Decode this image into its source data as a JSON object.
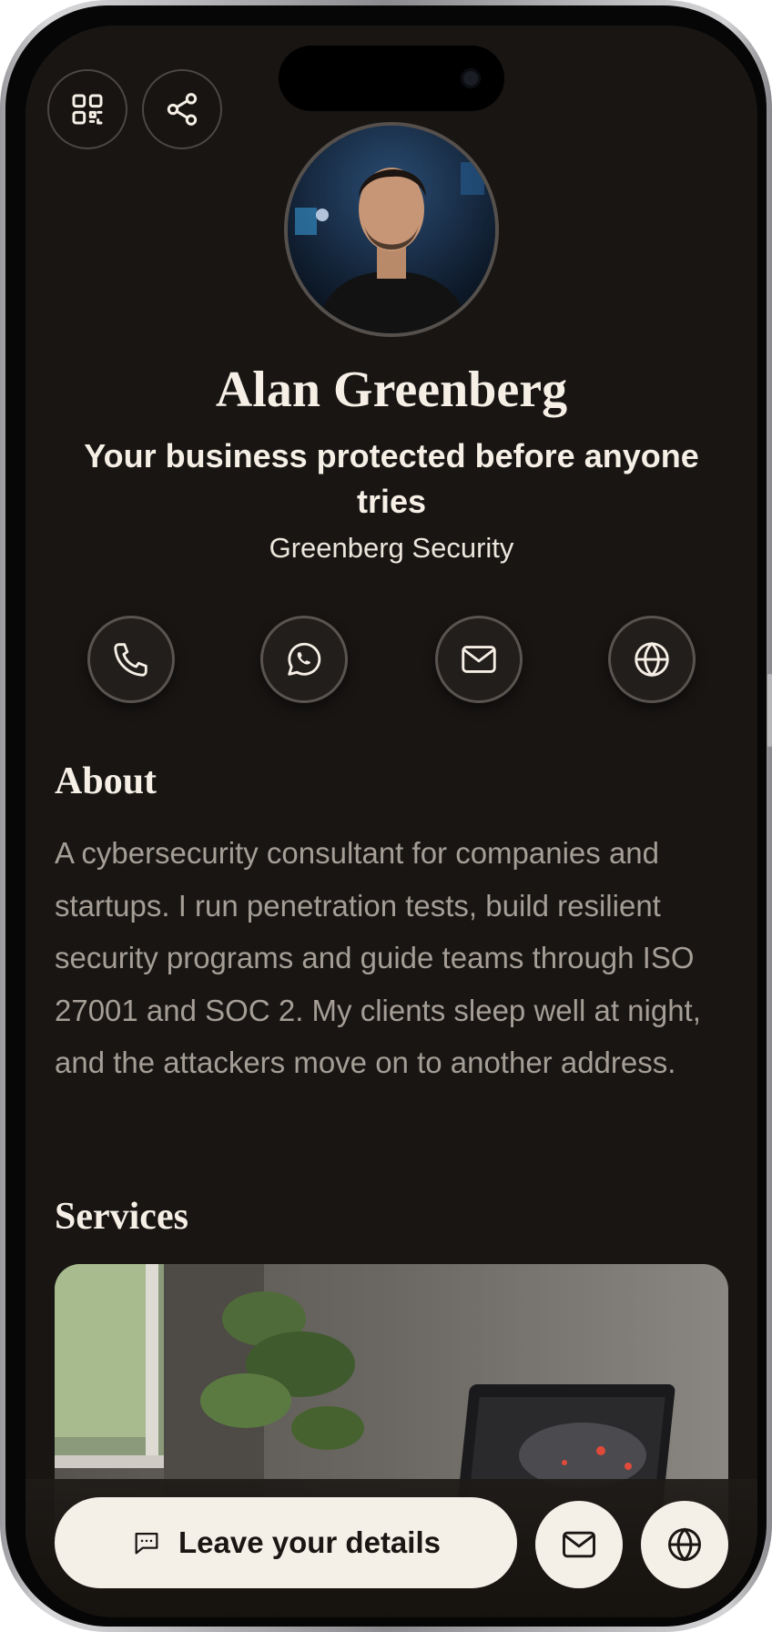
{
  "profile": {
    "name": "Alan Greenberg",
    "tagline": "Your business protected before anyone tries",
    "company": "Greenberg Security"
  },
  "top_actions": [
    {
      "icon": "qr-code-icon"
    },
    {
      "icon": "share-icon"
    }
  ],
  "contact_actions": [
    {
      "icon": "phone-icon"
    },
    {
      "icon": "whatsapp-icon"
    },
    {
      "icon": "mail-icon"
    },
    {
      "icon": "globe-icon"
    }
  ],
  "about": {
    "title": "About",
    "text": "A cybersecurity consultant for companies and startups. I run penetration tests, build resilient security programs and guide teams through ISO 27001 and SOC 2. My clients sleep well at night, and the attackers move on to another address."
  },
  "services": {
    "title": "Services"
  },
  "bottom_bar": {
    "details_label": "Leave your details",
    "details_icon": "message-icon",
    "mail_icon": "mail-icon",
    "globe_icon": "globe-icon"
  },
  "colors": {
    "background": "#181513",
    "text_primary": "#f5efe6",
    "text_muted": "#a59e96",
    "button_light": "#f4f0e8"
  }
}
